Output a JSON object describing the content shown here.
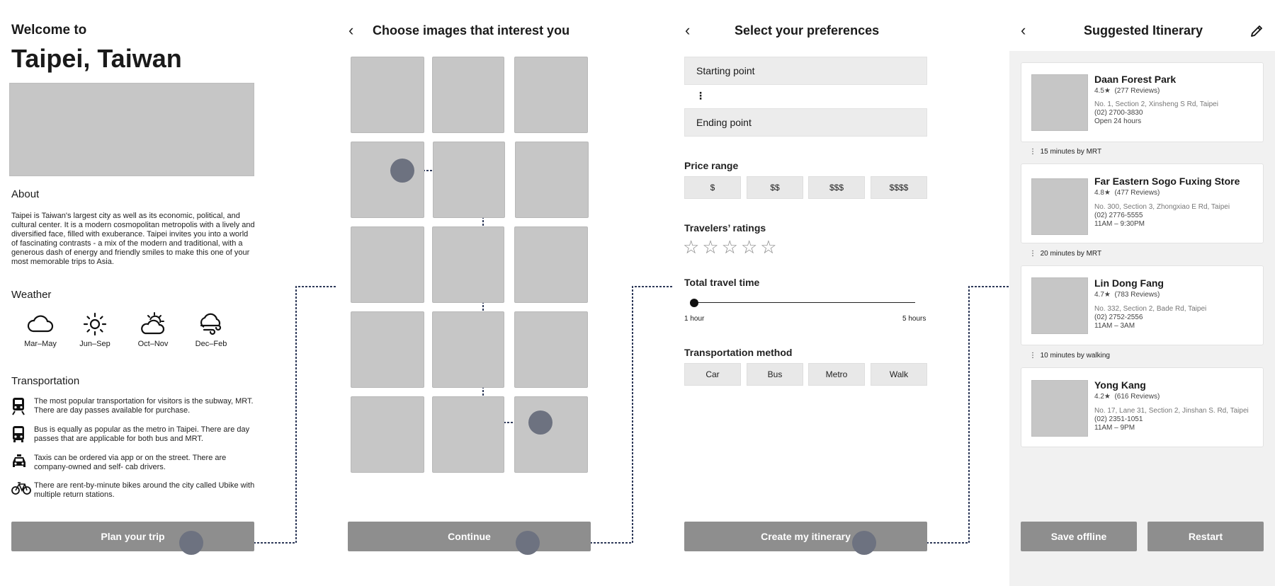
{
  "screen1": {
    "welcome": "Welcome to",
    "city": "Taipei, Taiwan",
    "about_heading": "About",
    "about_text": "Taipei is Taiwan's largest city as well as its economic, political, and cultural center. It is a modern cosmopolitan metropolis with a lively and diversified face, filled with exuberance. Taipei invites you into a world of fascinating contrasts - a mix of the modern and traditional, with a generous dash of energy and friendly smiles to make this one of your most memorable trips to Asia.",
    "weather_heading": "Weather",
    "weather": [
      {
        "icon": "cloud-icon",
        "label": "Mar–May"
      },
      {
        "icon": "sun-icon",
        "label": "Jun–Sep"
      },
      {
        "icon": "partly-cloudy-icon",
        "label": "Oct–Nov"
      },
      {
        "icon": "wind-cloud-icon",
        "label": "Dec–Feb"
      }
    ],
    "transport_heading": "Transportation",
    "transport": [
      {
        "icon": "subway-icon",
        "text": "The most popular transportation for visitors is the subway, MRT. There are day passes available for purchase."
      },
      {
        "icon": "bus-icon",
        "text": "Bus is equally as popular as the metro in Taipei. There are day passes that are applicable for both bus and MRT."
      },
      {
        "icon": "taxi-icon",
        "text": "Taxis can be ordered via app or on the street. There are company-owned and self- cab drivers."
      },
      {
        "icon": "bicycle-icon",
        "text": "There are rent-by-minute bikes around the city called Ubike with multiple return stations."
      }
    ],
    "cta": "Plan your trip"
  },
  "screen2": {
    "title": "Choose images that interest you",
    "cta": "Continue"
  },
  "screen3": {
    "title": "Select your preferences",
    "starting_point": "Starting point",
    "ending_point": "Ending point",
    "price_heading": "Price range",
    "prices": [
      "$",
      "$$",
      "$$$",
      "$$$$"
    ],
    "ratings_heading": "Travelers’ ratings",
    "rating_stars": 5,
    "time_heading": "Total travel time",
    "time_min": "1 hour",
    "time_max": "5 hours",
    "method_heading": "Transportation method",
    "methods": [
      "Car",
      "Bus",
      "Metro",
      "Walk"
    ],
    "cta": "Create my itinerary"
  },
  "screen4": {
    "title": "Suggested Itinerary",
    "places": [
      {
        "name": "Daan Forest Park",
        "rating": "4.5★",
        "reviews": "(277 Reviews)",
        "address": "No. 1, Section 2, Xinsheng S Rd, Taipei",
        "phone": "(02) 2700-3830",
        "hours": "Open 24 hours"
      },
      {
        "name": "Far Eastern Sogo Fuxing Store",
        "rating": "4.8★",
        "reviews": "(477 Reviews)",
        "address": "No. 300, Section 3, Zhongxiao E Rd, Taipei",
        "phone": "(02) 2776-5555",
        "hours": "11AM – 9:30PM"
      },
      {
        "name": "Lin Dong Fang",
        "rating": "4.7★",
        "reviews": "(783 Reviews)",
        "address": "No. 332, Section 2, Bade Rd, Taipei",
        "phone": "(02) 2752-2556",
        "hours": "11AM – 3AM"
      },
      {
        "name": "Yong Kang",
        "rating": "4.2★",
        "reviews": "(616 Reviews)",
        "address": "No. 17, Lane 31, Section 2, Jinshan S. Rd, Taipei",
        "phone": "(02) 2351-1051",
        "hours": "11AM – 9PM"
      }
    ],
    "travels": [
      "15 minutes by MRT",
      "20 minutes by MRT",
      "10 minutes by walking"
    ],
    "save": "Save offline",
    "restart": "Restart"
  },
  "colors": {
    "button": "#8e8e8e",
    "placeholder": "#c6c6c6",
    "flow_line": "#2f3a5a",
    "hotspot": "#6d7280"
  }
}
